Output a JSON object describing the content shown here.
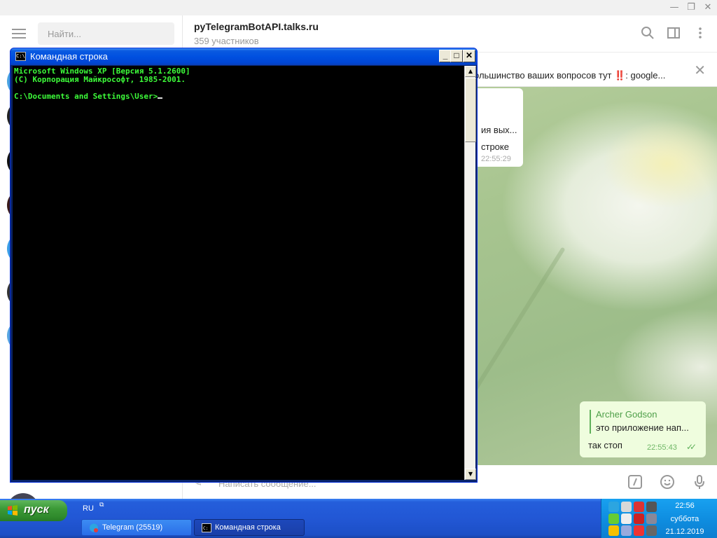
{
  "telegram": {
    "search_placeholder": "Найти...",
    "chat_title": "pyTelegramBotAPI.talks.ru",
    "chat_subtitle": "359 участников",
    "pinned_text": "ольшинство ваших вопросов тут ‼️: google...",
    "incoming": {
      "line1": "ия вых...",
      "line2": "строке",
      "time": "22:55:29"
    },
    "outgoing": {
      "reply_name": "Archer Godson",
      "reply_text": "это приложение нап...",
      "text": "так стоп",
      "time": "22:55:43"
    },
    "compose_placeholder": "Написать сообщение..."
  },
  "cmd": {
    "title": "Командная строка",
    "icon_label": "C:\\",
    "lines": [
      "Microsoft Windows XP [Версия 5.1.2600]",
      "(С) Корпорация Майкрософт, 1985-2001.",
      "",
      "C:\\Documents and Settings\\User>"
    ]
  },
  "taskbar": {
    "start_label": "пуск",
    "language": "RU",
    "tasks": [
      {
        "label": "Telegram (25519)"
      },
      {
        "label": "Командная строка"
      }
    ],
    "clock": {
      "time": "22:56",
      "day": "суббота",
      "date": "21.12.2019"
    },
    "tray_icons": [
      "telegram-tray-icon",
      "network-icon",
      "shield-icon",
      "volume-icon",
      "download-icon",
      "torrent-icon",
      "antivirus-icon",
      "update-icon",
      "emoji-icon",
      "media-icon",
      "opera-icon",
      "notify-icon"
    ]
  },
  "colors": {
    "cmd_text": "#3dfc3a",
    "xp_blue": "#245edb",
    "start_green": "#3c9a37",
    "telegram_green": "#4d9e48"
  }
}
